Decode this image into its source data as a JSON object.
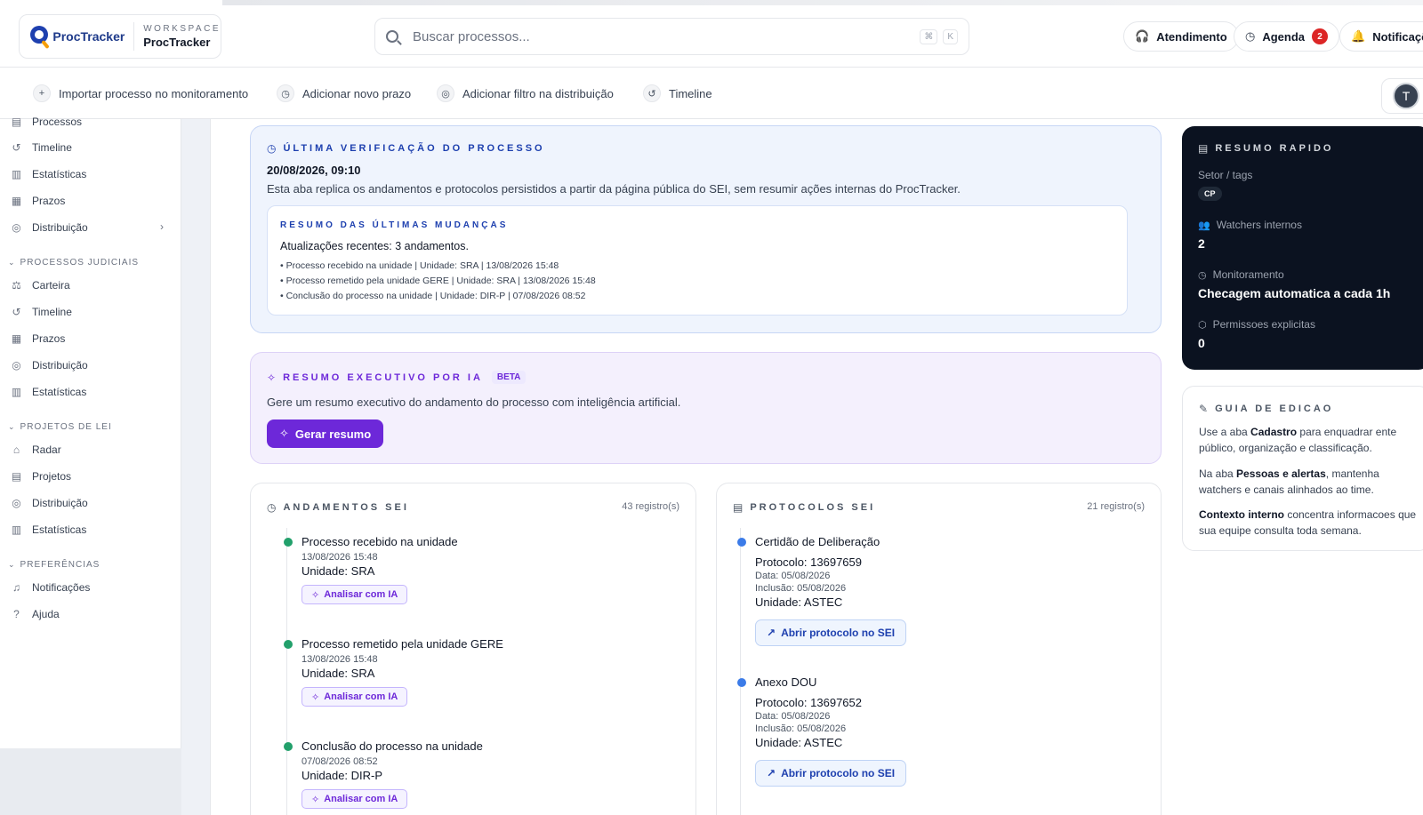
{
  "brand": {
    "logo": "ProcTracker",
    "workspace_label": "WORKSPACE",
    "workspace_name": "ProcTracker"
  },
  "search": {
    "placeholder": "Buscar processos...",
    "kbd": [
      "⌘",
      "K"
    ]
  },
  "top_actions": {
    "atendimento": "Atendimento",
    "agenda": "Agenda",
    "agenda_badge": "2",
    "notificacoes": "Notificaçõe"
  },
  "quick_actions": [
    "Importar processo no monitoramento",
    "Adicionar novo prazo",
    "Adicionar filtro na distribuição",
    "Timeline"
  ],
  "user": {
    "initial": "T"
  },
  "sidebar": {
    "group0": [
      "Processos",
      "Timeline",
      "Estatísticas",
      "Prazos",
      "Distribuição"
    ],
    "section1": "PROCESSOS JUDICIAIS",
    "group1": [
      "Carteira",
      "Timeline",
      "Prazos",
      "Distribuição",
      "Estatísticas"
    ],
    "section2": "PROJETOS DE LEI",
    "group2": [
      "Radar",
      "Projetos",
      "Distribuição",
      "Estatísticas"
    ],
    "section3": "PREFERÊNCIAS",
    "group3": [
      "Notificações",
      "Ajuda"
    ]
  },
  "verification": {
    "title": "ÚLTIMA VERIFICAÇÃO DO PROCESSO",
    "datetime": "20/08/2026, 09:10",
    "description": "Esta aba replica os andamentos e protocolos persistidos a partir da página pública do SEI, sem resumir ações internas do ProcTracker.",
    "changes_title": "RESUMO DAS ÚLTIMAS MUDANÇAS",
    "changes_summary": "Atualizações recentes: 3 andamentos.",
    "changes": [
      "• Processo recebido na unidade | Unidade: SRA | 13/08/2026 15:48",
      "• Processo remetido pela unidade GERE | Unidade: SRA | 13/08/2026 15:48",
      "• Conclusão do processo na unidade | Unidade: DIR-P | 07/08/2026 08:52"
    ]
  },
  "ai_summary": {
    "title": "RESUMO EXECUTIVO POR IA",
    "badge": "BETA",
    "description": "Gere um resumo executivo do andamento do processo com inteligência artificial.",
    "button": "Gerar resumo"
  },
  "andamentos": {
    "title": "ANDAMENTOS SEI",
    "count": "43 registro(s)",
    "ai_button": "Analisar com IA",
    "items": [
      {
        "title": "Processo recebido na unidade",
        "datetime": "13/08/2026 15:48",
        "unit": "Unidade: SRA"
      },
      {
        "title": "Processo remetido pela unidade GERE",
        "datetime": "13/08/2026 15:48",
        "unit": "Unidade: SRA"
      },
      {
        "title": "Conclusão do processo na unidade",
        "datetime": "07/08/2026 08:52",
        "unit": "Unidade: DIR-P"
      }
    ]
  },
  "protocolos": {
    "title": "PROTOCOLOS SEI",
    "count": "21 registro(s)",
    "open_button": "Abrir protocolo no SEI",
    "items": [
      {
        "title": "Certidão de Deliberação",
        "protocol": "Protocolo: 13697659",
        "date": "Data: 05/08/2026",
        "inclusion": "Inclusão: 05/08/2026",
        "unit": "Unidade: ASTEC"
      },
      {
        "title": "Anexo DOU",
        "protocol": "Protocolo: 13697652",
        "date": "Data: 05/08/2026",
        "inclusion": "Inclusão: 05/08/2026",
        "unit": "Unidade: ASTEC"
      }
    ]
  },
  "quick_summary": {
    "title": "RESUMO RAPIDO",
    "sector_label": "Setor / tags",
    "sector_tag": "CP",
    "watchers_label": "Watchers internos",
    "watchers_value": "2",
    "monitoring_label": "Monitoramento",
    "monitoring_value": "Checagem automatica a cada 1h",
    "permissions_label": "Permissoes explicitas",
    "permissions_value": "0"
  },
  "guide": {
    "title": "GUIA DE EDICAO",
    "p1_pre": "Use a aba ",
    "p1_bold": "Cadastro",
    "p1_post": " para enquadrar ente público, organização e classificação.",
    "p2_pre": "Na aba ",
    "p2_bold": "Pessoas e alertas",
    "p2_post": ", mantenha watchers e canais alinhados ao time.",
    "p3_bold": "Contexto interno",
    "p3_post": " concentra informacoes que sua equipe consulta toda semana."
  },
  "colors": {
    "accent_purple": "#6d28d9",
    "accent_blue": "#1e40af",
    "status_green": "#22a06b",
    "status_blue": "#3b7be8"
  }
}
